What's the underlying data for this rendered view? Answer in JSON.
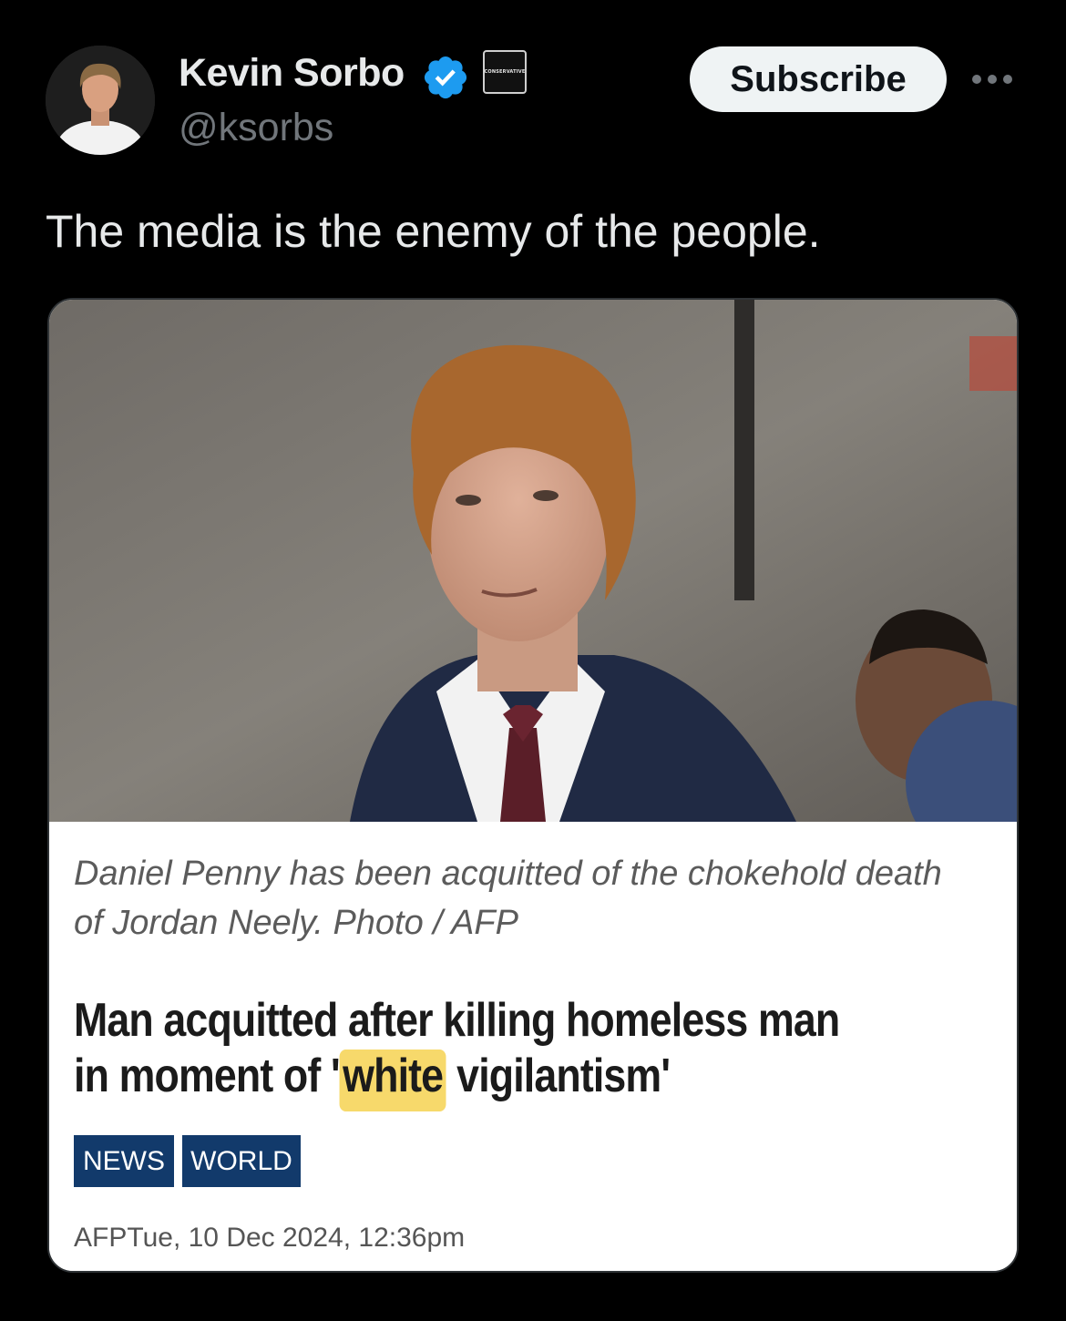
{
  "author": {
    "name": "Kevin Sorbo",
    "handle": "@ksorbs",
    "verified_icon": "verified-badge-icon",
    "affiliate_badge_text": "CONSERVATIVE"
  },
  "actions": {
    "subscribe_label": "Subscribe",
    "more_icon": "more-horizontal-icon"
  },
  "tweet": {
    "text": "The media is the enemy of the people."
  },
  "article": {
    "caption_line1": "Daniel Penny has been acquitted of the chokehold death",
    "caption_line2": "of Jordan Neely. Photo / AFP",
    "headline_line1": "Man acquitted after killing homeless man",
    "headline_line2_before": "in moment of '",
    "headline_highlight": "white",
    "headline_line2_after": " vigilantism'",
    "tags": [
      "NEWS",
      "WORLD"
    ],
    "source": "AFP",
    "date": "Tue, 10 Dec 2024, 12:36pm"
  },
  "colors": {
    "background": "#000000",
    "text_primary": "#e7e9ea",
    "text_secondary": "#71767b",
    "verified_blue": "#1d9bf0",
    "tag_blue": "#123a6b",
    "highlight": "#f7d96b"
  }
}
